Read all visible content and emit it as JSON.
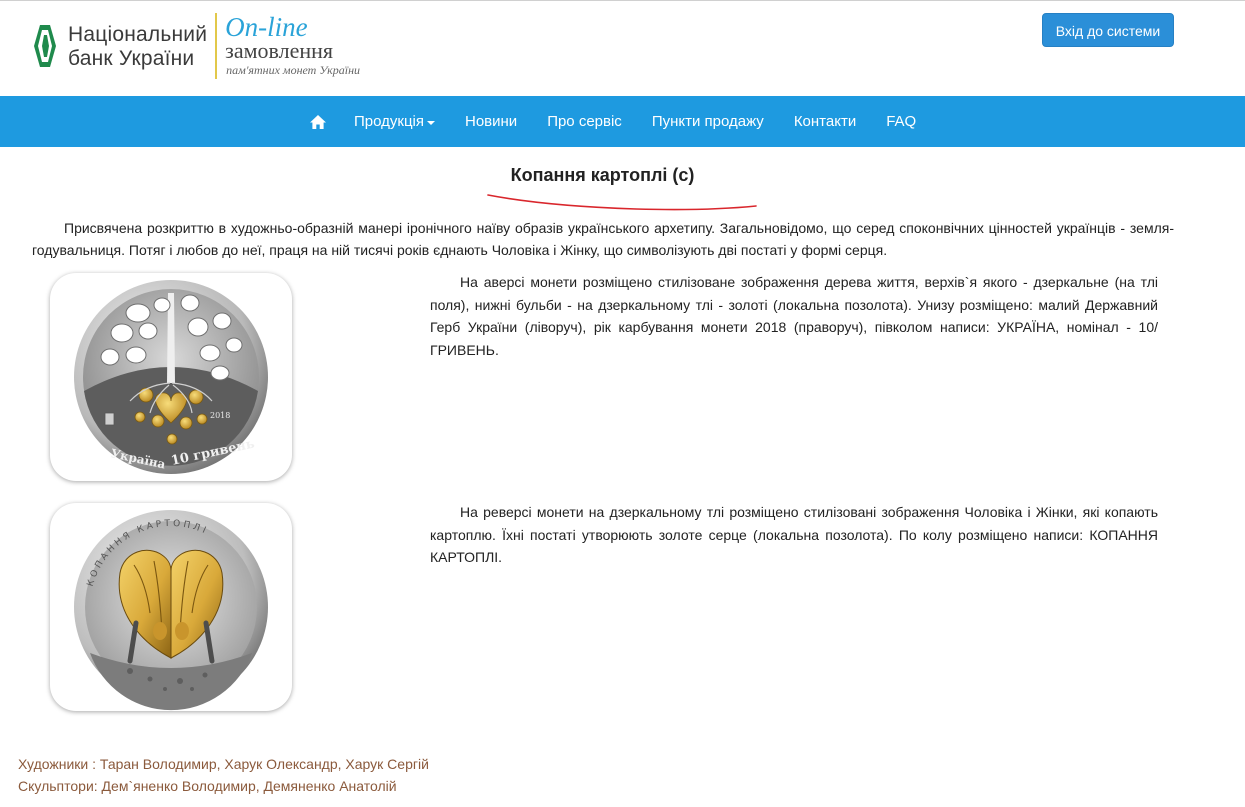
{
  "header": {
    "bank_name_line1": "Національний",
    "bank_name_line2": "банк України",
    "service_title": "On-line",
    "service_subtitle": "замовлення",
    "service_caption": "пам'ятних монет України",
    "login_label": "Вхід до системи"
  },
  "nav": {
    "home_icon": "home-icon",
    "items": [
      {
        "label": "Продукція",
        "has_dropdown": true
      },
      {
        "label": "Новини"
      },
      {
        "label": "Про сервіс"
      },
      {
        "label": "Пункти продажу"
      },
      {
        "label": "Контакти"
      },
      {
        "label": "FAQ"
      }
    ]
  },
  "product": {
    "title": "Копання картоплі (с)",
    "intro": "Присвячена розкриттю в художньо-образній манері іронічного наїву образів українського архетипу. Загальновідомо, що серед споконвічних цінностей українців - земля-годувальниця. Потяг і любов до неї, праця на ній тисячі років єднають Чоловіка і Жінку, що символізують дві постаті у формі серця.",
    "obverse": {
      "description": "На аверсі монети розміщено стилізоване зображення дерева життя, верхів`я якого - дзеркальне (на тлі поля), нижні бульби - на дзеркальному тлі - золоті (локальна позолота). Унизу розміщено: малий Державний Герб України (ліворуч), рік карбування монети 2018 (праворуч), півколом написи: УКРАЇНА, номінал - 10/ ГРИВЕНЬ.",
      "coin_year": "2018",
      "coin_text_left": "Україна",
      "coin_text_right": "10 гривень"
    },
    "reverse": {
      "description": "На реверсі монети на дзеркальному тлі розміщено стилізовані зображення Чоловіка і Жінки, які копають картоплю. Їхні постаті утворюють золоте серце (локальна позолота). По колу розміщено написи: КОПАННЯ КАРТОПЛІ.",
      "coin_text_top": "КОПАННЯ КАРТОПЛІ"
    }
  },
  "credits": {
    "artists": "Художники : Таран Володимир, Харук Олександр, Харук Сергій",
    "sculptors": "Скульптори: Дем`яненко Володимир, Демяненко Анатолій"
  },
  "colors": {
    "nav_bg": "#1e9ae0",
    "login_bg": "#2b8fd8",
    "accent_blue": "#2aa3d8",
    "credits_text": "#8b5a3c",
    "underline_red": "#d9262c",
    "gold": "#d9a93a"
  }
}
